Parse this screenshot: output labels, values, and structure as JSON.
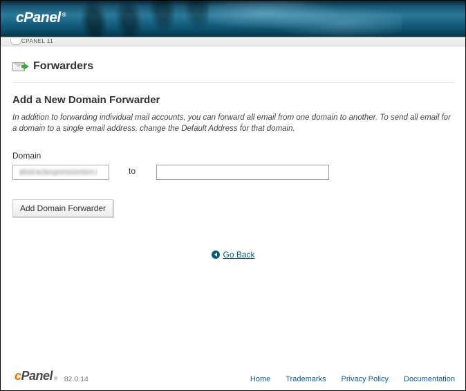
{
  "banner": {
    "logo_text": "cPanel",
    "logo_reg": "®"
  },
  "crumb": {
    "label": "CPANEL 11"
  },
  "page": {
    "title": "Forwarders",
    "section_title": "Add a New Domain Forwarder",
    "description": "In addition to forwarding individual mail accounts, you can forward all email from one domain to another. To send all email for a domain to a single email address, change the Default Address for that domain."
  },
  "form": {
    "domain_label": "Domain",
    "domain_options": [
      "abstractexpressionism.t"
    ],
    "domain_selected": "abstractexpressionism.t",
    "to_label": "to",
    "dest_value": "",
    "submit_label": "Add Domain Forwarder"
  },
  "goback": {
    "label": "Go Back"
  },
  "footer": {
    "logo_c": "c",
    "logo_rest": "Panel",
    "logo_reg": "®",
    "version": "82.0.14",
    "links": {
      "home": "Home",
      "trademarks": "Trademarks",
      "privacy": "Privacy Policy",
      "documentation": "Documentation"
    }
  }
}
